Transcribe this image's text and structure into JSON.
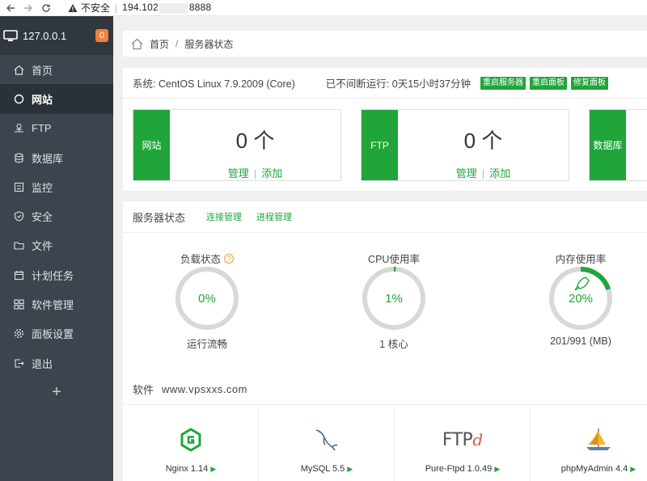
{
  "browser": {
    "insecure_label": "不安全",
    "address_host": "194.102",
    "address_port": "8888"
  },
  "sidebar": {
    "host": "127.0.0.1",
    "badge": "0",
    "items": [
      {
        "label": "首页",
        "icon": "home-icon"
      },
      {
        "label": "网站",
        "icon": "globe-icon",
        "active": true
      },
      {
        "label": "FTP",
        "icon": "ftp-icon"
      },
      {
        "label": "数据库",
        "icon": "database-icon"
      },
      {
        "label": "监控",
        "icon": "monitor-icon"
      },
      {
        "label": "安全",
        "icon": "shield-icon"
      },
      {
        "label": "文件",
        "icon": "folder-icon"
      },
      {
        "label": "计划任务",
        "icon": "calendar-icon"
      },
      {
        "label": "软件管理",
        "icon": "apps-icon"
      },
      {
        "label": "面板设置",
        "icon": "gear-icon"
      },
      {
        "label": "退出",
        "icon": "logout-icon"
      }
    ],
    "add_label": "+"
  },
  "breadcrumb": {
    "home": "首页",
    "separator": "/",
    "current": "服务器状态"
  },
  "system": {
    "os": "系统: CentOS Linux 7.9.2009 (Core)",
    "uptime": "已不间断运行: 0天15小时37分钟",
    "buttons": [
      "重启服务器",
      "重启面板",
      "修复面板"
    ]
  },
  "stats": [
    {
      "tag": "网站",
      "count": "0 个",
      "manage": "管理",
      "add": "添加"
    },
    {
      "tag": "FTP",
      "count": "0 个",
      "manage": "管理",
      "add": "添加"
    },
    {
      "tag": "数据库"
    }
  ],
  "server_status": {
    "title": "服务器状态",
    "links": [
      "连接管理",
      "进程管理"
    ],
    "gauges": [
      {
        "label": "负载状态",
        "help": "?",
        "value": "0%",
        "percent": 0,
        "sub": "运行流畅"
      },
      {
        "label": "CPU使用率",
        "value": "1%",
        "percent": 1,
        "sub": "1 核心"
      },
      {
        "label": "内存使用率",
        "value": "20%",
        "percent": 20,
        "sub": "201/991 (MB)"
      }
    ]
  },
  "software": {
    "title": "软件",
    "site": "www.vpsxxs.com",
    "items": [
      {
        "name": "Nginx 1.14",
        "icon": "nginx-icon"
      },
      {
        "name": "MySQL 5.5",
        "icon": "mysql-dolphin-icon"
      },
      {
        "name": "Pure-Ftpd 1.0.49",
        "icon": "ftpd-icon",
        "logo_text": "FTP",
        "logo_accent": "d"
      },
      {
        "name": "phpMyAdmin 4.4",
        "icon": "phpmyadmin-icon"
      }
    ],
    "arrow": "▶"
  },
  "colors": {
    "accent": "#20a53a",
    "sidebar_bg": "#3c444d",
    "badge": "#f0803c"
  }
}
